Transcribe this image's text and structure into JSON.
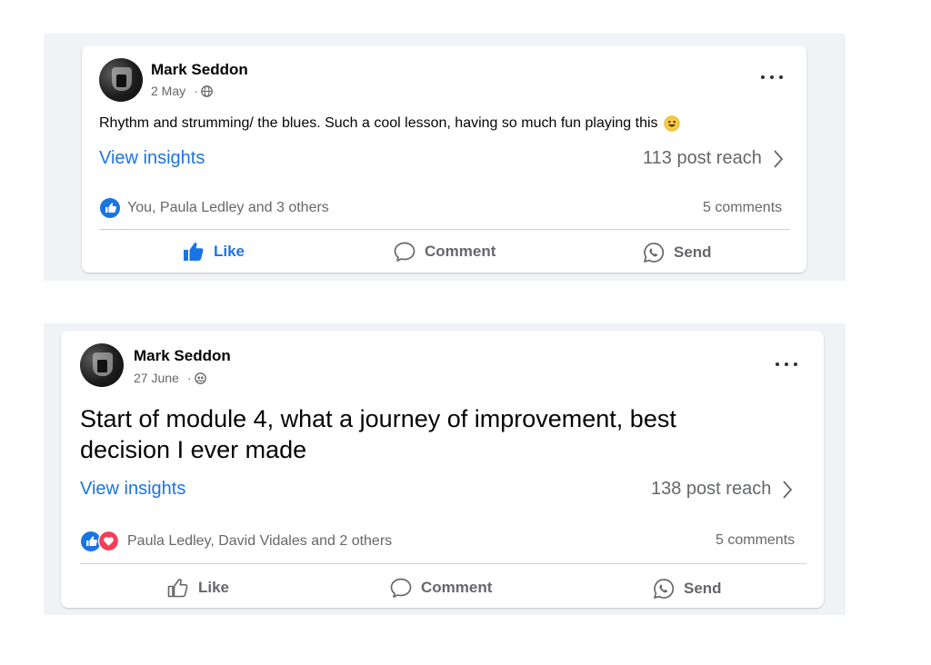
{
  "posts": [
    {
      "author": "Mark Seddon",
      "date": "2 May",
      "separator": "·",
      "text": "Rhythm and strumming/ the blues. Such a cool lesson, having so much fun playing this",
      "emoji": "grinning-face-emoji",
      "view_insights": "View insights",
      "reach": "113 post reach",
      "reactions_text": "You, Paula Ledley and 3 others",
      "reaction_icons": [
        "like-icon"
      ],
      "comments": "5 comments",
      "actions": {
        "like": "Like",
        "comment": "Comment",
        "send": "Send"
      },
      "liked": true
    },
    {
      "author": "Mark Seddon",
      "date": "27 June",
      "separator": "·",
      "text_line1": "Start of module 4, what a journey of improvement, best",
      "text_line2": "decision I ever made",
      "view_insights": "View insights",
      "reach": "138 post reach",
      "reactions_text": "Paula Ledley, David Vidales and 2 others",
      "reaction_icons": [
        "like-icon",
        "love-icon"
      ],
      "comments": "5 comments",
      "actions": {
        "like": "Like",
        "comment": "Comment",
        "send": "Send"
      },
      "liked": false
    }
  ],
  "colors": {
    "accent": "#1b74e4",
    "secondary_text": "#65676b",
    "love": "#f33e58",
    "panel_bg": "#f0f2f5"
  }
}
